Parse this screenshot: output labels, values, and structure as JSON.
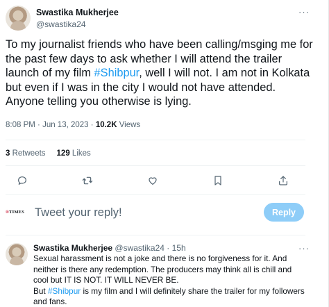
{
  "tweet": {
    "author_name": "Swastika Mukherjee",
    "author_handle": "@swastika24",
    "more_label": "···",
    "text_part1": "To my journalist friends who have been calling/msging me for the past few days to ask whether I will attend the trailer launch of my film ",
    "hashtag": "#Shibpur",
    "text_part2": ", well I will not. I am not in Kolkata but even if I was in the city I would not have attended. Anyone telling you otherwise is lying.",
    "time": "8:08 PM",
    "date": "Jun 13, 2023",
    "views_count": "10.2K",
    "views_label": "Views",
    "retweets_count": "3",
    "retweets_label": "Retweets",
    "likes_count": "129",
    "likes_label": "Likes"
  },
  "actions": {
    "icons": [
      "reply-icon",
      "retweet-icon",
      "like-icon",
      "bookmark-icon",
      "share-icon"
    ],
    "icon_color": "#536471"
  },
  "composer": {
    "logo_mark": "®",
    "logo_text": "TIMES",
    "placeholder": "Tweet your reply!",
    "button_label": "Reply",
    "button_color": "#8ecdf8"
  },
  "reply": {
    "author_name": "Swastika Mukherjee",
    "author_handle": "@swastika24",
    "separator": "·",
    "age": "15h",
    "more_label": "···",
    "line1": "Sexual harassment is not a joke and there is no forgiveness for it. And neither is there any redemption. The producers may think all is chill and cool but IT IS NOT. IT WILL NEVER BE.",
    "line2_prefix": "But ",
    "hashtag": "#Shibpur",
    "line2_rest": " is my film and I will definitely share the trailer for my followers and fans."
  },
  "colors": {
    "link": "#1d9bf0",
    "secondary_text": "#536471",
    "primary_text": "#0f1419",
    "divider": "#eff3f4"
  }
}
